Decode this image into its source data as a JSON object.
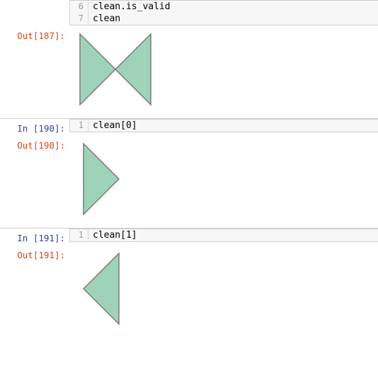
{
  "cells": [
    {
      "type": "code_tail",
      "lines": [
        {
          "n": "6",
          "text": "clean.is_valid"
        },
        {
          "n": "7",
          "text": "clean"
        }
      ]
    },
    {
      "type": "out",
      "label_word": "Out",
      "label_num": "187",
      "svg": "bowtie"
    },
    {
      "type": "in",
      "label_word": "In ",
      "label_num": "190",
      "lines": [
        {
          "n": "1",
          "text": "clean[0]"
        }
      ]
    },
    {
      "type": "out",
      "label_word": "Out",
      "label_num": "190",
      "svg": "tri_right"
    },
    {
      "type": "in",
      "label_word": "In ",
      "label_num": "191",
      "lines": [
        {
          "n": "1",
          "text": "clean[1]"
        }
      ]
    },
    {
      "type": "out",
      "label_word": "Out",
      "label_num": "191",
      "svg": "tri_left"
    }
  ],
  "shapes": {
    "fill": "#9fd3b9",
    "stroke": "#7a7a7a",
    "stroke_width": "1.5"
  }
}
